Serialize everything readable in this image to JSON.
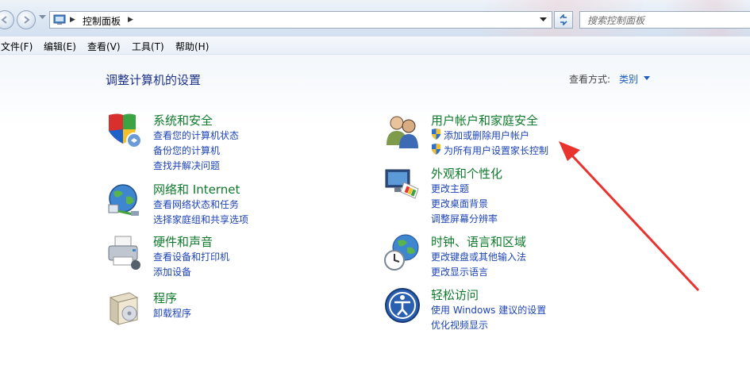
{
  "address_bar": {
    "breadcrumb": "控制面板",
    "search_placeholder": "搜索控制面板"
  },
  "menu": {
    "items": [
      "文件(F)",
      "编辑(E)",
      "查看(V)",
      "工具(T)",
      "帮助(H)"
    ]
  },
  "main": {
    "title": "调整计算机的设置",
    "view_by_label": "查看方式:",
    "view_by_value": "类别"
  },
  "categories": {
    "system_security": {
      "title": "系统和安全",
      "links": [
        "查看您的计算机状态",
        "备份您的计算机",
        "查找并解决问题"
      ]
    },
    "network_internet": {
      "title": "网络和 Internet",
      "links": [
        "查看网络状态和任务",
        "选择家庭组和共享选项"
      ]
    },
    "hardware_sound": {
      "title": "硬件和声音",
      "links": [
        "查看设备和打印机",
        "添加设备"
      ]
    },
    "programs": {
      "title": "程序",
      "links": [
        "卸载程序"
      ]
    },
    "user_accounts": {
      "title": "用户帐户和家庭安全",
      "links": [
        "添加或删除用户帐户",
        "为所有用户设置家长控制"
      ]
    },
    "appearance": {
      "title": "外观和个性化",
      "links": [
        "更改主题",
        "更改桌面背景",
        "调整屏幕分辨率"
      ]
    },
    "clock_language": {
      "title": "时钟、语言和区域",
      "links": [
        "更改键盘或其他输入法",
        "更改显示语言"
      ]
    },
    "ease_of_access": {
      "title": "轻松访问",
      "links": [
        "使用 Windows 建议的设置",
        "优化视频显示"
      ]
    }
  },
  "annotation": {
    "arrow_color": "#e8332f"
  },
  "icons": {
    "nav": [
      "back-arrow-icon",
      "forward-arrow-icon",
      "history-dropdown-icon",
      "refresh-icon"
    ],
    "categories": [
      "security-shield-icon",
      "network-globe-icon",
      "printer-icon",
      "programs-box-icon",
      "users-icon",
      "appearance-monitor-icon",
      "clock-globe-icon",
      "accessibility-icon"
    ]
  }
}
